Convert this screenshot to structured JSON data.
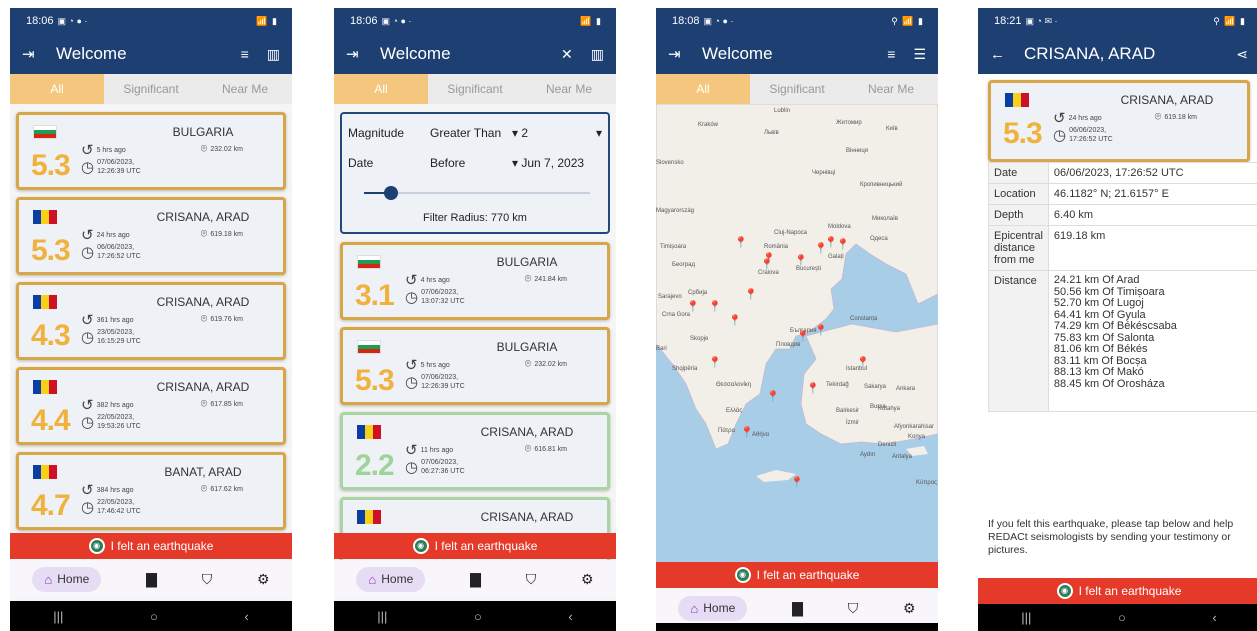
{
  "status": {
    "p1": {
      "time": "18:06"
    },
    "p2": {
      "time": "18:06"
    },
    "p3": {
      "time": "18:08"
    },
    "p4": {
      "time": "18:21"
    }
  },
  "appbar": {
    "welcome": "Welcome",
    "detail_title": "CRISANA, ARAD"
  },
  "tabs": {
    "all": "All",
    "significant": "Significant",
    "near_me": "Near Me"
  },
  "felt_button": "I felt an earthquake",
  "bottom_nav": {
    "home": "Home"
  },
  "list1": [
    {
      "mag": "5.3",
      "flag": "bg",
      "place": "BULGARIA",
      "ago": "5 hrs ago",
      "date": "07/06/2023,",
      "time": "12:26:39 UTC",
      "dist": "232.02 km",
      "style": "orange"
    },
    {
      "mag": "5.3",
      "flag": "ro",
      "place": "CRISANA, ARAD",
      "ago": "24 hrs ago",
      "date": "06/06/2023,",
      "time": "17:26:52 UTC",
      "dist": "619.18 km",
      "style": "orange"
    },
    {
      "mag": "4.3",
      "flag": "ro",
      "place": "CRISANA, ARAD",
      "ago": "361 hrs ago",
      "date": "23/05/2023,",
      "time": "16:15:29 UTC",
      "dist": "619.76 km",
      "style": "orange"
    },
    {
      "mag": "4.4",
      "flag": "ro",
      "place": "CRISANA, ARAD",
      "ago": "382 hrs ago",
      "date": "22/05/2023,",
      "time": "19:53:26 UTC",
      "dist": "617.85 km",
      "style": "orange"
    },
    {
      "mag": "4.7",
      "flag": "ro",
      "place": "BANAT, ARAD",
      "ago": "384 hrs ago",
      "date": "22/05/2023,",
      "time": "17:46:42 UTC",
      "dist": "617.62 km",
      "style": "orange"
    }
  ],
  "filter": {
    "magnitude_label": "Magnitude",
    "magnitude_op": "Greater Than",
    "magnitude_value": "2",
    "date_label": "Date",
    "date_op": "Before",
    "date_value": "Jun 7, 2023",
    "radius_text": "Filter Radius: 770 km",
    "radius_fraction": 0.12
  },
  "list2": [
    {
      "mag": "3.1",
      "flag": "bg",
      "place": "BULGARIA",
      "ago": "4 hrs ago",
      "date": "07/06/2023,",
      "time": "13:07:32 UTC",
      "dist": "241.84 km",
      "style": "orange"
    },
    {
      "mag": "5.3",
      "flag": "bg",
      "place": "BULGARIA",
      "ago": "5 hrs ago",
      "date": "07/06/2023,",
      "time": "12:26:39 UTC",
      "dist": "232.02 km",
      "style": "orange"
    },
    {
      "mag": "2.2",
      "flag": "ro",
      "place": "CRISANA, ARAD",
      "ago": "11 hrs ago",
      "date": "07/06/2023,",
      "time": "06:27:36 UTC",
      "dist": "616.81 km",
      "style": "green"
    },
    {
      "mag": "",
      "flag": "ro",
      "place": "CRISANA, ARAD",
      "ago": "",
      "date": "",
      "time": "",
      "dist": "",
      "style": "green"
    }
  ],
  "map_labels": [
    "Lublin",
    "Kraków",
    "Львів",
    "Житомир",
    "Київ",
    "Slovensko",
    "Вінниця",
    "Чернівці",
    "Кропивницький",
    "Magyarország",
    "Cluj-Napoca",
    "Moldova",
    "Миколаїв",
    "Timișoara",
    "România",
    "Одеса",
    "Београд",
    "Galați",
    "Craiova",
    "București",
    "Sarajevo",
    "Србија",
    "Constanța",
    "Crna Gora",
    "Skopje",
    "България",
    "Пловдив",
    "Shqipëria",
    "Bari",
    "Istanbul",
    "Θεσσαλονίκη",
    "Tekirdağ",
    "Sakarya",
    "Ankara",
    "Ελλάς",
    "Bursa",
    "Balıkesir",
    "Kütahya",
    "Πάτρα",
    "İzmir",
    "Afyonkarahisar",
    "Αθήνα",
    "Denizli",
    "Konya",
    "Aydın",
    "Antalya",
    "Κύπρος"
  ],
  "detail": {
    "place": "CRISANA, ARAD",
    "mag": "5.3",
    "ago": "24 hrs ago",
    "date": "06/06/2023,",
    "time": "17:26:52 UTC",
    "dist": "619.18 km",
    "rows": [
      {
        "k": "Date",
        "v": "06/06/2023, 17:26:52 UTC"
      },
      {
        "k": "Location",
        "v": "46.1182° N; 21.6157° E"
      },
      {
        "k": "Depth",
        "v": "6.40 km"
      },
      {
        "k": "Epicentral distance from me",
        "v": "619.18 km"
      }
    ],
    "distance_label": "Distance",
    "distances": [
      "24.21 km Of Arad",
      "50.56 km Of Timișoara",
      "52.70 km Of Lugoj",
      "64.41 km Of Gyula",
      "74.29 km Of Békéscsaba",
      "75.83 km Of Salonta",
      "81.06 km Of Békés",
      "83.11 km Of Bocșa",
      "88.13 km Of Makó",
      "88.45 km Of Orosháza"
    ],
    "help_text": "If you felt this earthquake, please tap below and help REDACt seismologists by sending your testimony or pictures."
  }
}
